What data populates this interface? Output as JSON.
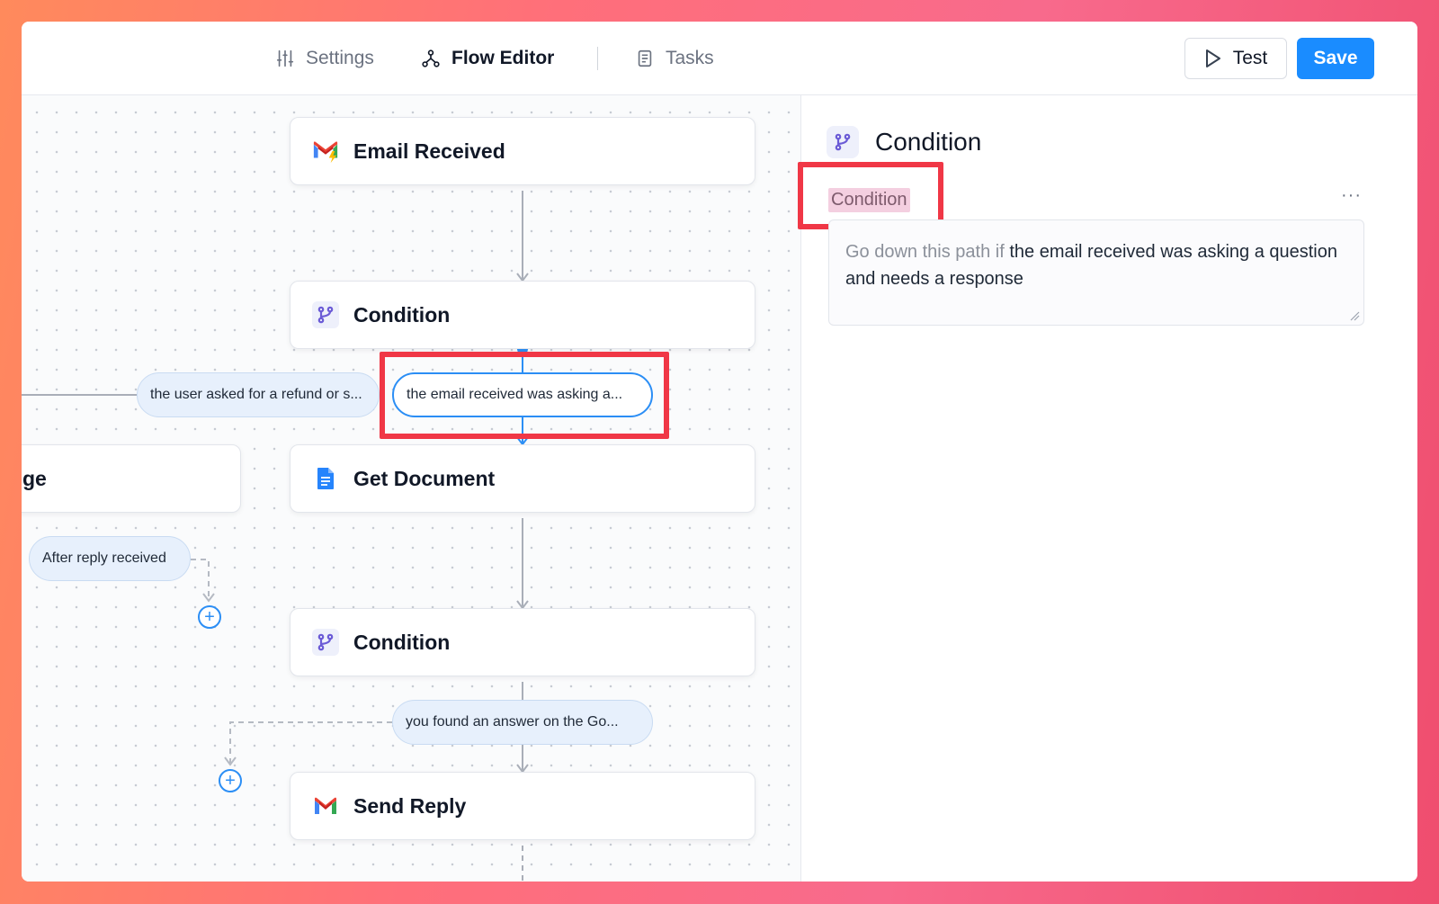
{
  "topbar": {
    "tabs": [
      {
        "label": "Settings",
        "icon": "sliders-icon",
        "active": false
      },
      {
        "label": "Flow Editor",
        "icon": "flow-icon",
        "active": true
      },
      {
        "label": "Tasks",
        "icon": "document-icon",
        "active": false
      }
    ],
    "test_label": "Test",
    "save_label": "Save"
  },
  "canvas": {
    "nodes": [
      {
        "label": "Email Received",
        "icon": "gmail-trigger-icon"
      },
      {
        "label": "Condition",
        "icon": "branch-icon"
      },
      {
        "label": "Get Document",
        "icon": "google-docs-icon"
      },
      {
        "label": "Condition",
        "icon": "branch-icon"
      },
      {
        "label": "Send Reply",
        "icon": "gmail-icon"
      }
    ],
    "partial_node_label": "ge",
    "branches": [
      {
        "label": "the user asked for a refund or s..."
      },
      {
        "label": "the email received was asking a..."
      },
      {
        "label": "After reply received"
      },
      {
        "label": "you found an answer on the Go..."
      }
    ]
  },
  "panel": {
    "title": "Condition",
    "condition_label": "Condition",
    "more": "···",
    "condition_prefix": "Go down this path if",
    "condition_text": "the email received was asking a question and needs a response"
  },
  "colors": {
    "accent": "#1a8cff",
    "highlight": "#f03746",
    "branch_fill": "#e7f0fc",
    "condition_icon": "#6b5bd6"
  }
}
